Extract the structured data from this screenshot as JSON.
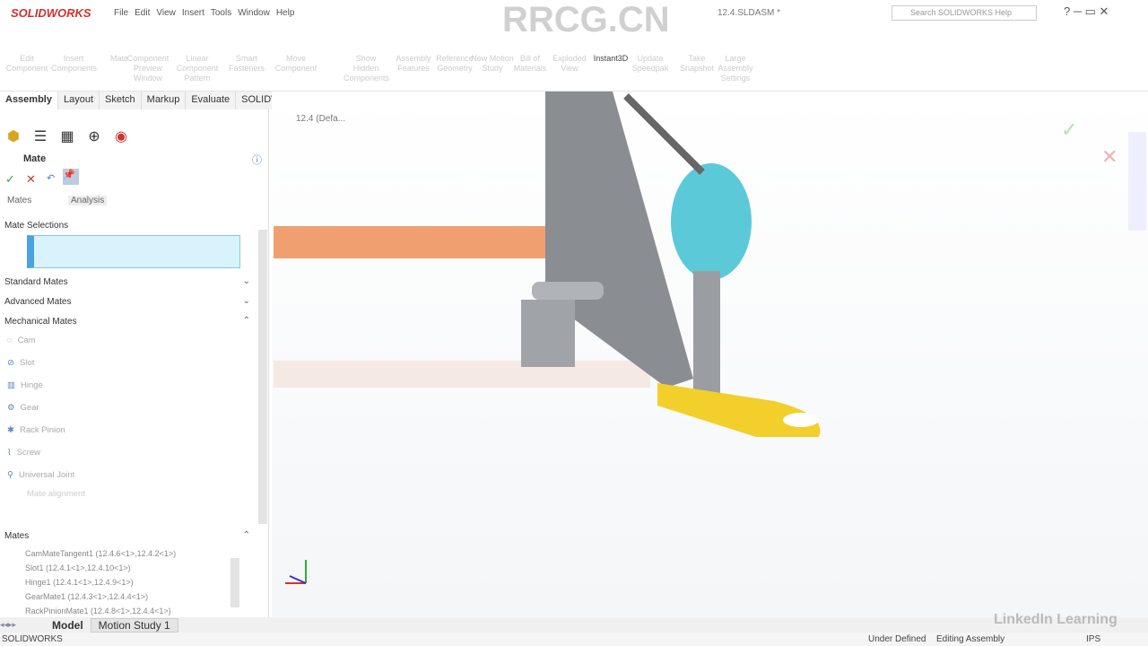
{
  "app": {
    "logo": "SOLIDWORKS",
    "menu": [
      "File",
      "Edit",
      "View",
      "Insert",
      "Tools",
      "Window",
      "Help"
    ],
    "doc_title": "12.4.SLDASM *",
    "search_placeholder": "Search SOLIDWORKS Help"
  },
  "ribbon": [
    "Edit Component",
    "Insert Components",
    "Mate",
    "Component Preview Window",
    "Linear Component Pattern",
    "Smart Fasteners",
    "Move Component",
    "Show Hidden Components",
    "Assembly Features",
    "Reference Geometry",
    "New Motion Study",
    "Bill of Materials",
    "Exploded View",
    "Instant3D",
    "Update Speedpak",
    "Take Snapshot",
    "Large Assembly Settings"
  ],
  "tabs": [
    "Assembly",
    "Layout",
    "Sketch",
    "Markup",
    "Evaluate",
    "SOLIDWORKS Add-Ins"
  ],
  "panel": {
    "title": "Mate",
    "subtabs": [
      "Mates",
      "Analysis"
    ],
    "sections": {
      "selections": "Mate Selections",
      "standard": "Standard Mates",
      "advanced": "Advanced Mates",
      "mechanical": "Mechanical Mates",
      "mates": "Mates"
    },
    "mechanical": [
      "Cam",
      "Slot",
      "Hinge",
      "Gear",
      "Rack Pinion",
      "Screw",
      "Universal Joint"
    ],
    "mate_alignment": "Mate alignment",
    "mates_list": [
      "CamMateTangent1 (12.4.6<1>,12.4.2<1>)",
      "Slot1 (12.4.1<1>,12.4.10<1>)",
      "Hinge1 (12.4.1<1>,12.4.9<1>)",
      "GearMate1 (12.4.3<1>,12.4.4<1>)",
      "RackPinionMate1 (12.4.8<1>,12.4.4<1>)"
    ]
  },
  "tree_root": "12.4  (Defa...",
  "bottom_tabs": [
    "Model",
    "Motion Study 1"
  ],
  "status": {
    "app": "SOLIDWORKS",
    "state": "Under Defined",
    "mode": "Editing Assembly",
    "units": "IPS"
  },
  "watermarks": [
    "RRCG.CN",
    "LinkedIn Learning"
  ]
}
